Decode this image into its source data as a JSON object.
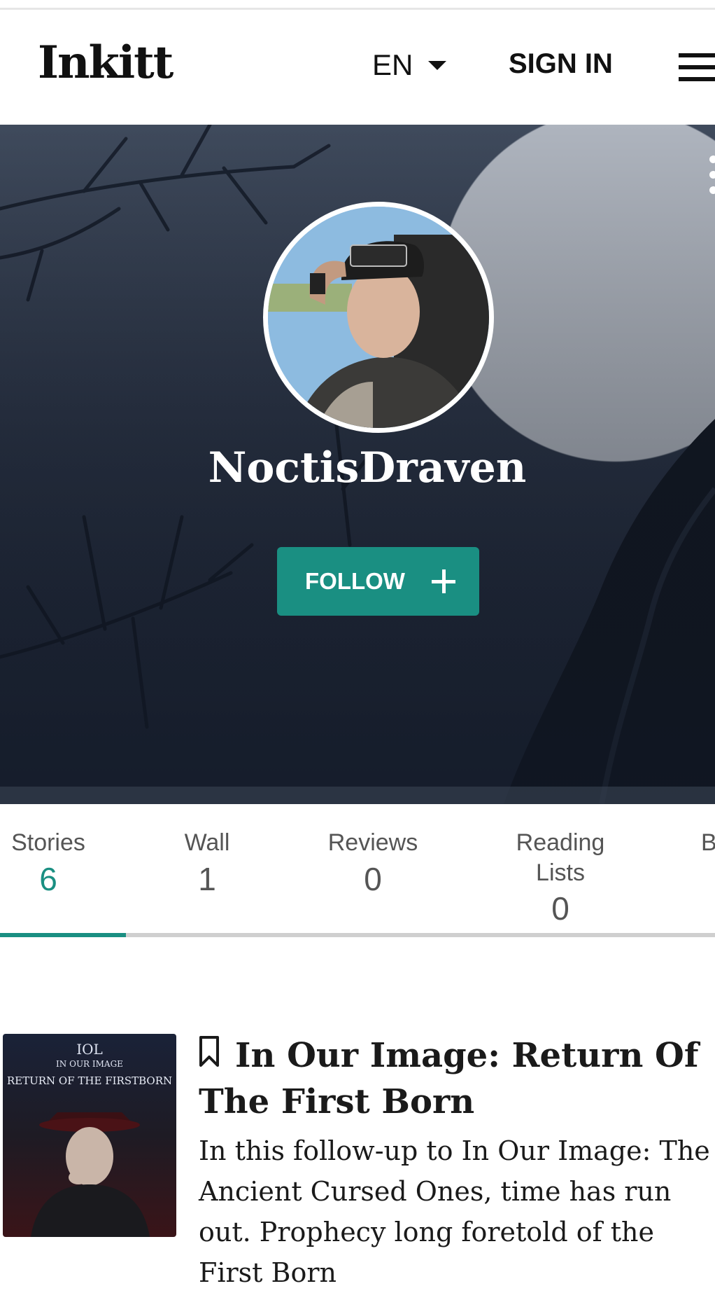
{
  "header": {
    "logo": "Inkitt",
    "language": "EN",
    "sign_in": "SIGN IN"
  },
  "profile": {
    "username": "NoctisDraven",
    "follow_label": "FOLLOW"
  },
  "tabs": [
    {
      "label": "Stories",
      "count": "6"
    },
    {
      "label": "Wall",
      "count": "1"
    },
    {
      "label": "Reviews",
      "count": "0"
    },
    {
      "label": "Reading Lists",
      "count": "0"
    },
    {
      "label": "B",
      "count": ""
    }
  ],
  "story": {
    "cover_line1": "IOL",
    "cover_line2": "IN OUR IMAGE",
    "cover_line3": "RETURN OF THE FIRSTBORN",
    "title": "In Our Image: Return Of The First Born",
    "description": "In this follow-up to In Our Image: The Ancient Cursed Ones, time has run out. Prophecy long foretold of the First Born"
  },
  "colors": {
    "accent": "#1a8f82",
    "hero_dark": "#1e2739",
    "moon": "#aeb4be"
  }
}
